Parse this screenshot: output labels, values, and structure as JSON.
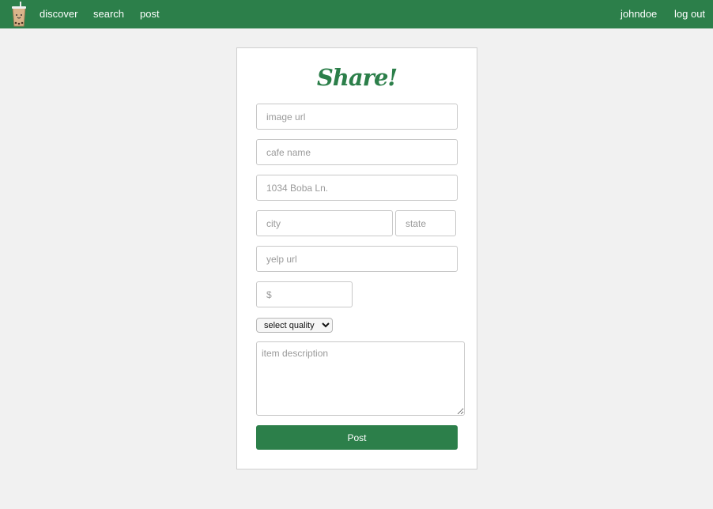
{
  "nav": {
    "logo_icon": "bubble-tea-cup-icon",
    "brand_color": "#2c7f4a",
    "links": [
      "discover",
      "search",
      "post"
    ],
    "user": "johndoe",
    "logout": "log out"
  },
  "form": {
    "title": "Share!",
    "image_url_placeholder": "image url",
    "cafe_name_placeholder": "cafe name",
    "address_placeholder": "1034 Boba Ln.",
    "city_placeholder": "city",
    "state_placeholder": "state",
    "yelp_url_placeholder": "yelp url",
    "price_placeholder": "$",
    "quality_selected": "select quality",
    "description_placeholder": "item description",
    "submit_label": "Post"
  }
}
